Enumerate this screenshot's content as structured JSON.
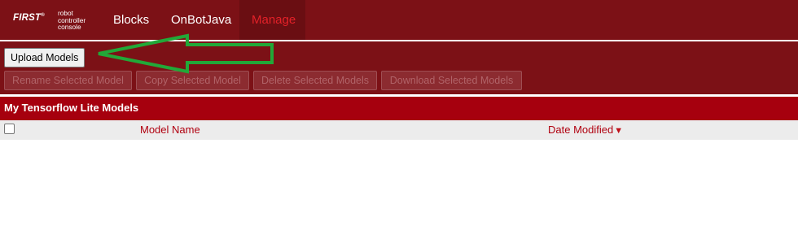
{
  "nav": {
    "brand": {
      "first": "FIRST",
      "subtitle_lines": [
        "robot",
        "controller",
        "console"
      ]
    },
    "items": [
      {
        "label": "Blocks",
        "active": false
      },
      {
        "label": "OnBotJava",
        "active": false
      },
      {
        "label": "Manage",
        "active": true
      }
    ]
  },
  "toolbar": {
    "upload_label": "Upload Models",
    "rename_label": "Rename Selected Model",
    "copy_label": "Copy Selected Model",
    "delete_label": "Delete Selected Models",
    "download_label": "Download Selected Models"
  },
  "models_section": {
    "title": "My Tensorflow Lite Models",
    "columns": {
      "model_name": "Model Name",
      "date_modified": "Date Modified",
      "sort_icon": "sort-descending-icon"
    },
    "rows": []
  },
  "annotation": {
    "arrow_color": "#22a838",
    "arrow_icon": "arrow-left-icon"
  },
  "colors": {
    "nav_bg": "#7c1116",
    "active_nav_text": "#e32128",
    "section_header_bg": "#a6000e",
    "column_header_text": "#b0000f"
  }
}
